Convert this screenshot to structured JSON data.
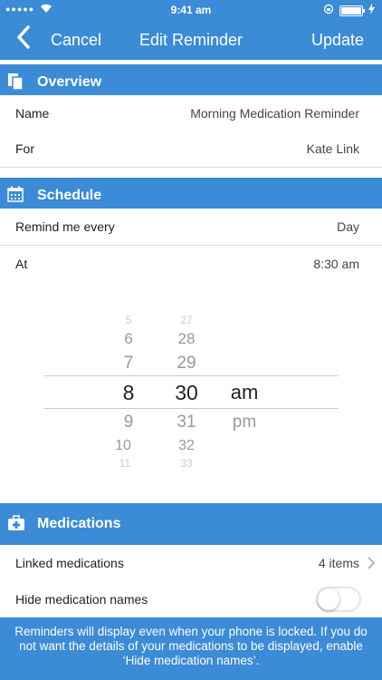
{
  "status_bar": {
    "signal": "●●●●●",
    "time": "9:41 am"
  },
  "nav": {
    "cancel_label": "Cancel",
    "title": "Edit Reminder",
    "update_label": "Update"
  },
  "overview": {
    "header": "Overview",
    "rows": [
      {
        "label": "Name",
        "value": "Morning Medication Reminder"
      },
      {
        "label": "For",
        "value": "Kate Link"
      }
    ]
  },
  "schedule": {
    "header": "Schedule",
    "rows": [
      {
        "label": "Remind me every",
        "value": "Day"
      },
      {
        "label": "At",
        "value": "8:30 am"
      }
    ],
    "picker": {
      "hours": [
        "5",
        "6",
        "7",
        "8",
        "9",
        "10",
        "11"
      ],
      "minutes": [
        "27",
        "28",
        "29",
        "30",
        "31",
        "32",
        "33"
      ],
      "periods": [
        "am",
        "pm"
      ],
      "selected_hour": "8",
      "selected_minute": "30",
      "selected_period": "am"
    }
  },
  "medications": {
    "header": "Medications",
    "linked_label": "Linked medications",
    "linked_value": "4 items",
    "hide_label": "Hide medication names",
    "hide_enabled": false
  },
  "footer_note": "Reminders will display even when your phone is locked. If you do not want the details of your medications to be displayed, enable ‘Hide medication names’.",
  "colors": {
    "accent": "#3b8bd6",
    "divider": "#dddddd"
  }
}
